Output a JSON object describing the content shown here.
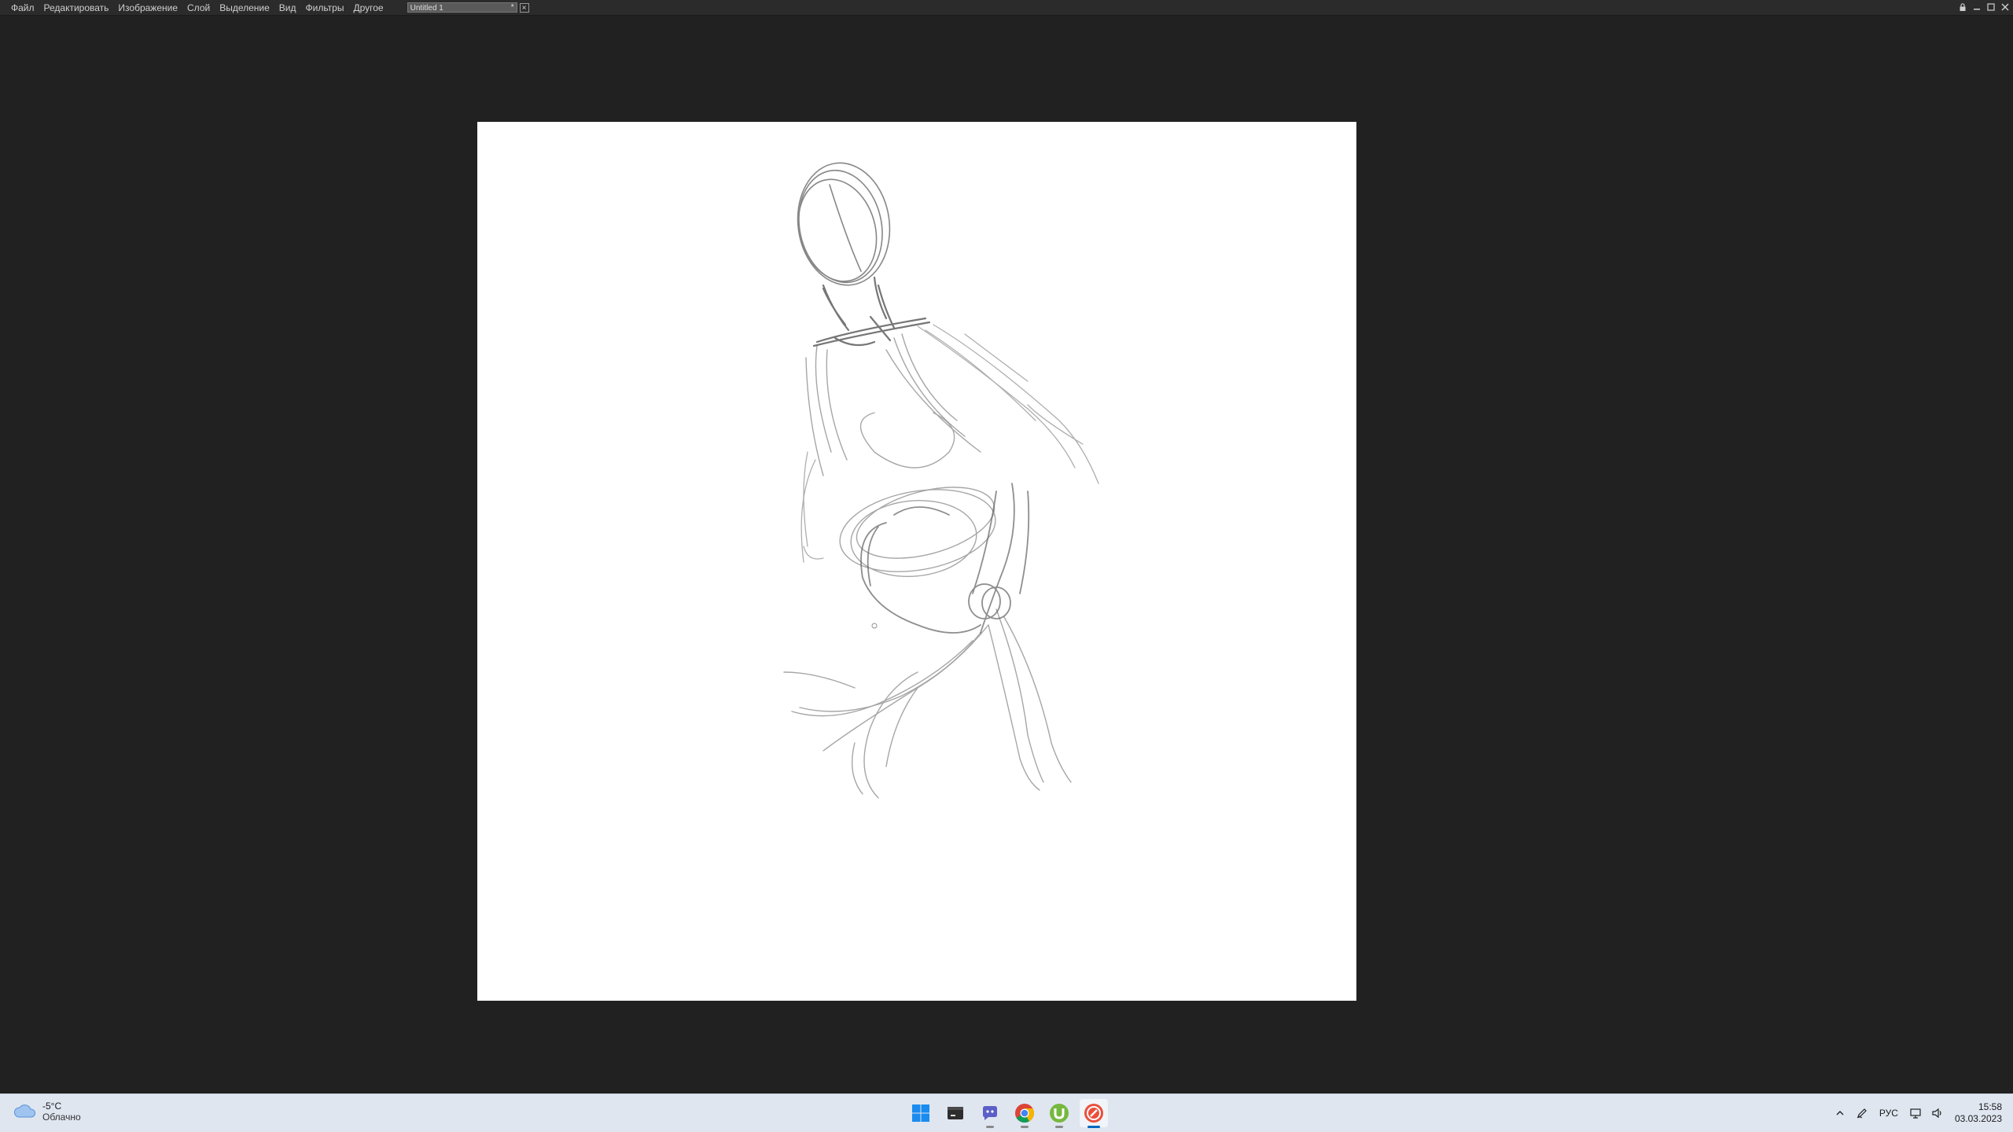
{
  "menubar": {
    "items": [
      {
        "id": "file",
        "label": "Файл"
      },
      {
        "id": "edit",
        "label": "Редактировать"
      },
      {
        "id": "image",
        "label": "Изображение"
      },
      {
        "id": "layer",
        "label": "Слой"
      },
      {
        "id": "select",
        "label": "Выделение"
      },
      {
        "id": "view",
        "label": "Вид"
      },
      {
        "id": "filters",
        "label": "Фильтры"
      },
      {
        "id": "other",
        "label": "Другое"
      }
    ],
    "document_tab": {
      "title": "Untitled 1",
      "modified_marker": "*"
    },
    "icons": [
      "lock-icon",
      "minimize-icon",
      "maximize-icon",
      "close-icon"
    ]
  },
  "canvas": {
    "background": "#ffffff",
    "stroke_color": "#6a6a6a"
  },
  "taskbar": {
    "weather": {
      "temp": "-5°C",
      "condition": "Облачно",
      "icon": "cloud-icon"
    },
    "apps": [
      {
        "name": "start-button",
        "icon": "windows-logo-icon"
      },
      {
        "name": "taskbar-app-terminal",
        "icon": "terminal-icon"
      },
      {
        "name": "taskbar-app-teams",
        "icon": "teams-icon"
      },
      {
        "name": "taskbar-app-chrome",
        "icon": "chrome-icon"
      },
      {
        "name": "taskbar-app-utorrent",
        "icon": "utorrent-icon"
      },
      {
        "name": "taskbar-app-paint",
        "icon": "paint-app-icon"
      }
    ],
    "tray": {
      "language": "РУС",
      "time": "15:58",
      "date": "03.03.2023"
    }
  },
  "colors": {
    "menubar_bg": "#2b2b2b",
    "workspace_bg": "#212121",
    "taskbar_bg": "#dfe6f0",
    "accent": "#0067c0"
  }
}
